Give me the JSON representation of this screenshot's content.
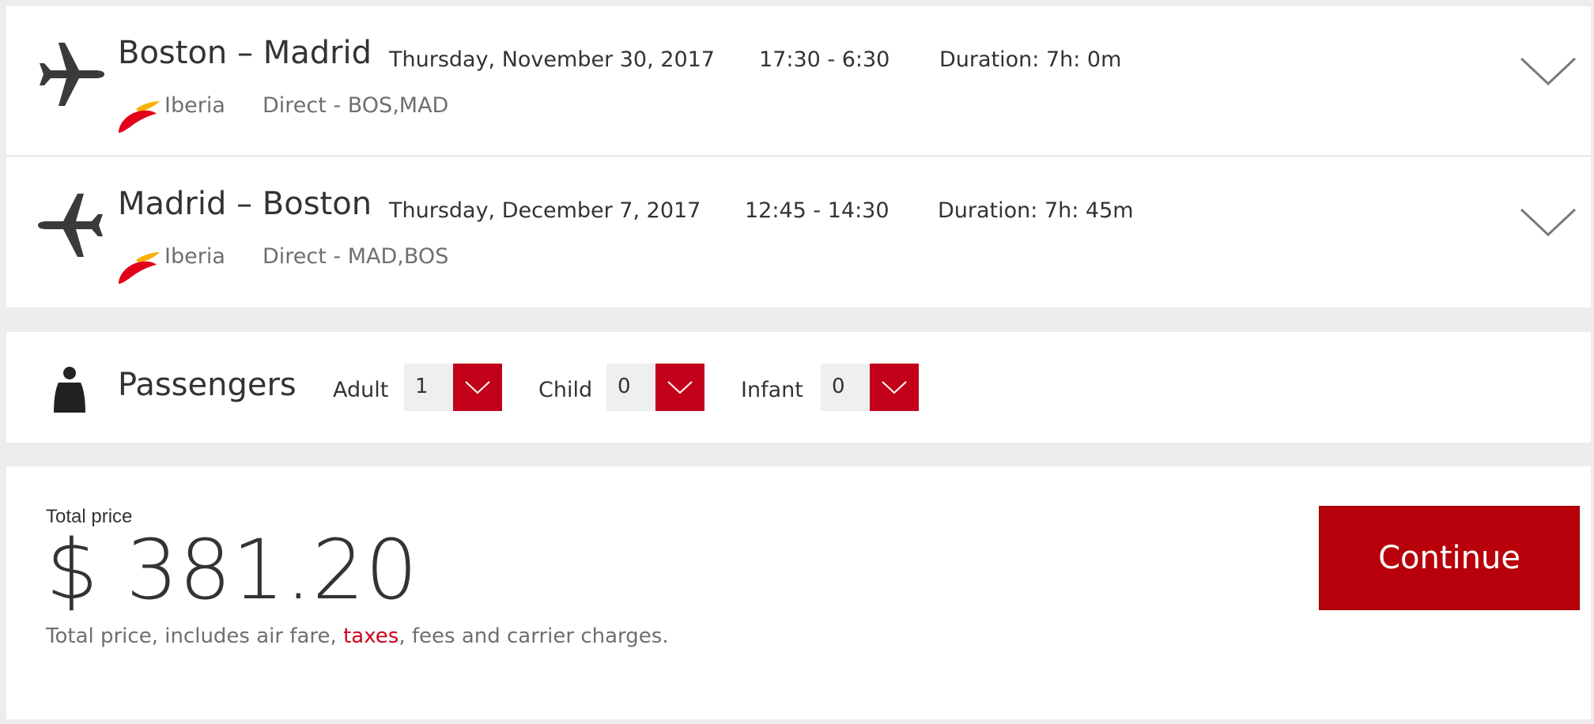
{
  "flights": [
    {
      "route": "Boston – Madrid",
      "date": "Thursday, November 30, 2017",
      "time": "17:30 - 6:30",
      "duration": "Duration: 7h: 0m",
      "airline": "Iberia",
      "stops": "Direct - BOS,MAD",
      "icon": "plane-icon"
    },
    {
      "route": "Madrid – Boston",
      "date": "Thursday, December 7, 2017",
      "time": "12:45 - 14:30",
      "duration": "Duration: 7h: 45m",
      "airline": "Iberia",
      "stops": "Direct - MAD,BOS",
      "icon": "plane-icon"
    }
  ],
  "passengers": {
    "title": "Passengers",
    "icon": "person-icon",
    "adult_label": "Adult",
    "adult_value": "1",
    "child_label": "Child",
    "child_value": "0",
    "infant_label": "Infant",
    "infant_value": "0"
  },
  "price": {
    "label": "Total price",
    "amount": "$ 381.20",
    "note_before": "Total price, includes air fare, ",
    "note_link": "taxes",
    "note_after": ", fees and carrier charges.",
    "continue_label": "Continue"
  },
  "colors": {
    "accent": "#c20019",
    "button": "#b70009",
    "link": "#d0021b"
  }
}
